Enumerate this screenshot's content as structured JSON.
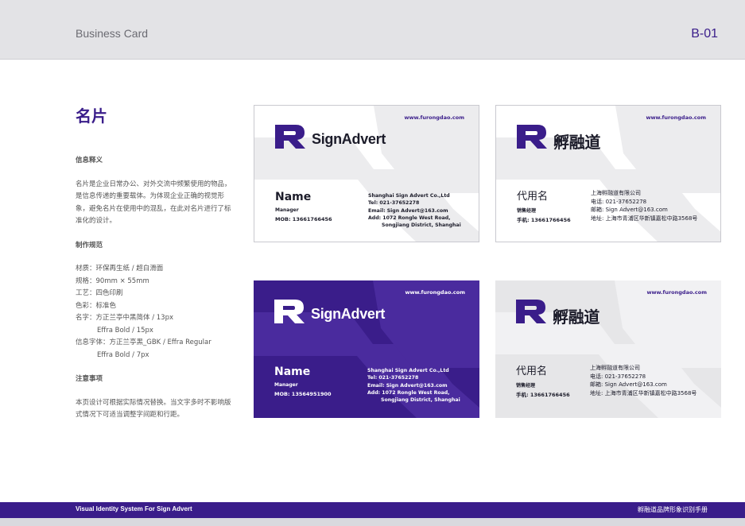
{
  "header": {
    "title": "Business Card",
    "code": "B-01"
  },
  "heading": "名片",
  "sidebar": {
    "section1": "信息释义",
    "paragraph1": "名片是企业日常办公、对外交流中频繁使用的物品，是信息传递的重要载体。为体现企业正确的视觉形象，避免名片在使用中的混乱，在此对名片进行了标准化的设计。",
    "section2": "制作规范",
    "specs": [
      "材质：环保再生纸 / 超白滑面",
      "规格：90mm × 55mm",
      "工艺：四色印刷",
      "色彩：标准色",
      "名字：方正兰亭中黑简体 / 13px"
    ],
    "spec_indent1": "Effra Bold / 15px",
    "spec6": "信息字体：方正兰亭黑_GBK / Effra Regular",
    "spec_indent2": "Effra Bold / 7px",
    "section3": "注意事项",
    "paragraph3": "本页设计可根据实际情况替换。当文字多时不影响版式情况下可适当调整字间距和行距。"
  },
  "cards": {
    "url": "www.furongdao.com",
    "en_logo": "SignAdvert",
    "cn_logo": "孵融道",
    "en": {
      "name": "Name",
      "role": "Manager",
      "mob_light": "MOB: 13661766456",
      "mob_purple": "MOB: 13564951900",
      "company": "Shanghai Sign Advert Co.,Ltd",
      "tel": "Tel: 021-37652278",
      "email": "Email: Sign Advert@163.com",
      "add1": "Add: 1072 Rongle West Road,",
      "add2": "Songjiang District, Shanghai"
    },
    "cn": {
      "name": "代用名",
      "role": "销售经理",
      "mob": "手机: 13661766456",
      "company": "上海孵融道有限公司",
      "tel": "电话: 021-37652278",
      "email": "邮箱: Sign Advert@163.com",
      "addr": "地址: 上海市青浦区华新镇嘉松中路3568号"
    }
  },
  "footer": {
    "left": "Visual Identity System For Sign Advert",
    "right": "孵融道品牌形象识别手册"
  },
  "colors": {
    "brand": "#3a1d8a",
    "grey": "#e6e6e8"
  }
}
